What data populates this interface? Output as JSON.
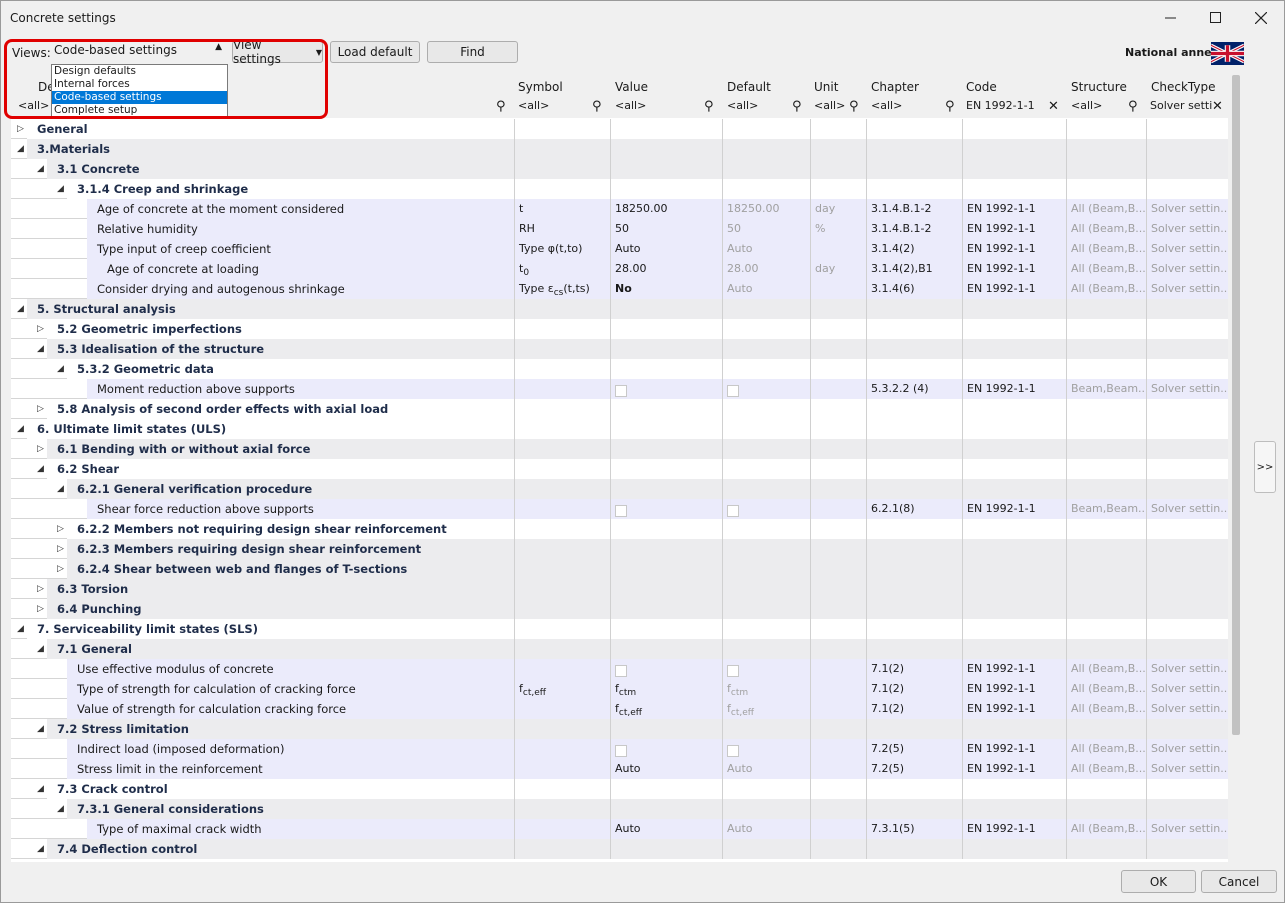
{
  "window": {
    "title": "Concrete settings"
  },
  "toolbar": {
    "views_label": "Views:",
    "views_value": "Code-based settings",
    "view_settings": "View settings",
    "load_default": "Load default",
    "find": "Find",
    "national_annex": "National annex:"
  },
  "views_options": [
    "Design defaults",
    "Internal forces",
    "Code-based settings",
    "Complete setup"
  ],
  "columns": {
    "description": "De",
    "symbol": "Symbol",
    "value": "Value",
    "default": "Default",
    "unit": "Unit",
    "chapter": "Chapter",
    "code": "Code",
    "structure": "Structure",
    "checktype": "CheckType"
  },
  "filters": {
    "description": "<all>",
    "symbol": "<all>",
    "value": "<all>",
    "default": "<all>",
    "unit": "<all>",
    "chapter": "<all>",
    "code": "EN 1992-1-1",
    "structure": "<all>",
    "checktype": "Solver setti"
  },
  "rows": [
    {
      "level": 0,
      "group": true,
      "toggle": "▷",
      "text": "General",
      "style": "w"
    },
    {
      "level": 0,
      "group": true,
      "toggle": "◢",
      "text": "3.Materials",
      "style": "g"
    },
    {
      "level": 1,
      "group": true,
      "toggle": "◢",
      "text": "3.1 Concrete",
      "style": "g"
    },
    {
      "level": 2,
      "group": true,
      "toggle": "◢",
      "text": "3.1.4 Creep and shrinkage",
      "style": "w"
    },
    {
      "level": 3,
      "group": false,
      "text": "Age of concrete at the moment considered",
      "symbol": "t",
      "value": "18250.00",
      "default": "18250.00",
      "unit": "day",
      "chapter": "3.1.4.B.1-2",
      "code": "EN 1992-1-1",
      "structure": "All (Beam,B...",
      "checktype": "Solver settin..."
    },
    {
      "level": 3,
      "group": false,
      "text": "Relative humidity",
      "symbol": "RH",
      "value": "50",
      "default": "50",
      "unit": "%",
      "chapter": "3.1.4.B.1-2",
      "code": "EN 1992-1-1",
      "structure": "All (Beam,B...",
      "checktype": "Solver settin..."
    },
    {
      "level": 3,
      "group": false,
      "text": "Type input of creep coefficient",
      "symbol": "Type φ(t,to)",
      "value": "Auto",
      "default": "Auto",
      "unit": "",
      "chapter": "3.1.4(2)",
      "code": "EN 1992-1-1",
      "structure": "All (Beam,B...",
      "checktype": "Solver settin..."
    },
    {
      "level": 3,
      "indent": 10,
      "group": false,
      "text": "Age of concrete at loading",
      "symbol": "t",
      "symsub": "0",
      "value": "28.00",
      "default": "28.00",
      "unit": "day",
      "chapter": "3.1.4(2),B1",
      "code": "EN 1992-1-1",
      "structure": "All (Beam,B...",
      "checktype": "Solver settin..."
    },
    {
      "level": 3,
      "group": false,
      "text": "Consider drying and autogenous shrinkage",
      "symbol": "Type ε",
      "symsub": "cs",
      "symsuffix": "(t,ts)",
      "value": "No",
      "valuebold": true,
      "default": "Auto",
      "unit": "",
      "chapter": "3.1.4(6)",
      "code": "EN 1992-1-1",
      "structure": "All (Beam,B...",
      "checktype": "Solver settin..."
    },
    {
      "level": 0,
      "group": true,
      "toggle": "◢",
      "text": "5. Structural analysis",
      "style": "g"
    },
    {
      "level": 1,
      "group": true,
      "toggle": "▷",
      "text": "5.2 Geometric imperfections",
      "style": "w"
    },
    {
      "level": 1,
      "group": true,
      "toggle": "◢",
      "text": "5.3 Idealisation of the structure",
      "style": "g"
    },
    {
      "level": 2,
      "group": true,
      "toggle": "◢",
      "text": "5.3.2 Geometric data",
      "style": "w"
    },
    {
      "level": 3,
      "group": false,
      "text": "Moment reduction above supports",
      "symbol": "",
      "check": true,
      "chapter": "5.3.2.2 (4)",
      "code": "EN 1992-1-1",
      "structure": "Beam,Beam...",
      "checktype": "Solver settin..."
    },
    {
      "level": 1,
      "group": true,
      "toggle": "▷",
      "text": "5.8 Analysis of second order effects with axial load",
      "style": "w"
    },
    {
      "level": 0,
      "group": true,
      "toggle": "◢",
      "text": "6. Ultimate limit states (ULS)",
      "style": "w"
    },
    {
      "level": 1,
      "group": true,
      "toggle": "▷",
      "text": "6.1 Bending with or without axial force",
      "style": "g"
    },
    {
      "level": 1,
      "group": true,
      "toggle": "◢",
      "text": "6.2 Shear",
      "style": "w"
    },
    {
      "level": 2,
      "group": true,
      "toggle": "◢",
      "text": "6.2.1 General verification procedure",
      "style": "g"
    },
    {
      "level": 3,
      "group": false,
      "text": "Shear force reduction above supports",
      "symbol": "",
      "check": true,
      "chapter": "6.2.1(8)",
      "code": "EN 1992-1-1",
      "structure": "Beam,Beam...",
      "checktype": "Solver settin..."
    },
    {
      "level": 2,
      "group": true,
      "toggle": "▷",
      "text": "6.2.2 Members not requiring design shear reinforcement",
      "style": "w"
    },
    {
      "level": 2,
      "group": true,
      "toggle": "▷",
      "text": "6.2.3 Members requiring design shear reinforcement",
      "style": "g"
    },
    {
      "level": 2,
      "group": true,
      "toggle": "▷",
      "text": "6.2.4 Shear between web and flanges of T-sections",
      "style": "g"
    },
    {
      "level": 1,
      "group": true,
      "toggle": "▷",
      "text": "6.3 Torsion",
      "style": "g"
    },
    {
      "level": 1,
      "group": true,
      "toggle": "▷",
      "text": "6.4 Punching",
      "style": "g"
    },
    {
      "level": 0,
      "group": true,
      "toggle": "◢",
      "text": "7. Serviceability limit states (SLS)",
      "style": "w"
    },
    {
      "level": 1,
      "group": true,
      "toggle": "◢",
      "text": "7.1 General",
      "style": "g"
    },
    {
      "level": 2,
      "group": false,
      "text": "Use effective modulus of concrete",
      "symbol": "",
      "check": true,
      "chapter": "7.1(2)",
      "code": "EN 1992-1-1",
      "structure": "All (Beam,B...",
      "checktype": "Solver settin..."
    },
    {
      "level": 2,
      "group": false,
      "text": "Type of strength for calculation of cracking force",
      "symbol": "f",
      "symsub": "ct,eff",
      "value": "f",
      "valuesub": "ctm",
      "default": "f",
      "defaultsub": "ctm",
      "chapter": "7.1(2)",
      "code": "EN 1992-1-1",
      "structure": "All (Beam,B...",
      "checktype": "Solver settin..."
    },
    {
      "level": 2,
      "group": false,
      "text": "Value of strength for calculation cracking force",
      "symbol": "",
      "value": "f",
      "valuesub": "ct,eff",
      "default": "f",
      "defaultsub": "ct,eff",
      "chapter": "7.1(2)",
      "code": "EN 1992-1-1",
      "structure": "All (Beam,B...",
      "checktype": "Solver settin..."
    },
    {
      "level": 1,
      "group": true,
      "toggle": "◢",
      "text": "7.2 Stress limitation",
      "style": "g"
    },
    {
      "level": 2,
      "group": false,
      "text": "Indirect load (imposed deformation)",
      "symbol": "",
      "check": true,
      "chapter": "7.2(5)",
      "code": "EN 1992-1-1",
      "structure": "All (Beam,B...",
      "checktype": "Solver settin..."
    },
    {
      "level": 2,
      "group": false,
      "text": "Stress limit in the reinforcement",
      "symbol": "",
      "value": "Auto",
      "default": "Auto",
      "chapter": "7.2(5)",
      "code": "EN 1992-1-1",
      "structure": "All (Beam,B...",
      "checktype": "Solver settin..."
    },
    {
      "level": 1,
      "group": true,
      "toggle": "◢",
      "text": "7.3 Crack control",
      "style": "w"
    },
    {
      "level": 2,
      "group": true,
      "toggle": "◢",
      "text": "7.3.1 General considerations",
      "style": "g"
    },
    {
      "level": 3,
      "group": false,
      "text": "Type of maximal crack width",
      "symbol": "",
      "value": "Auto",
      "default": "Auto",
      "chapter": "7.3.1(5)",
      "code": "EN 1992-1-1",
      "structure": "All (Beam,B...",
      "checktype": "Solver settin..."
    },
    {
      "level": 1,
      "group": true,
      "toggle": "◢",
      "text": "7.4 Deflection control",
      "style": "g"
    }
  ],
  "side_button": ">>",
  "footer": {
    "ok": "OK",
    "cancel": "Cancel"
  }
}
